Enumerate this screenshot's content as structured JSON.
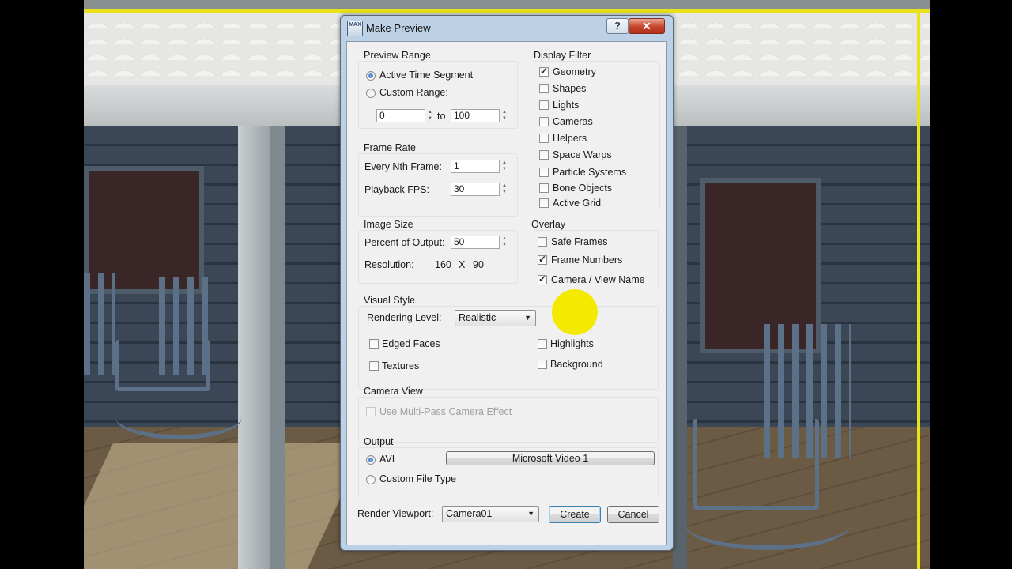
{
  "dialog": {
    "title": "Make Preview",
    "app_icon_text": "MAX",
    "help_glyph": "?",
    "close_glyph": "✕"
  },
  "preview_range": {
    "title": "Preview Range",
    "active_time_segment": "Active Time Segment",
    "custom_range": "Custom Range:",
    "from_value": "0",
    "to_label": "to",
    "to_value": "100",
    "selected": "Active Time Segment"
  },
  "frame_rate": {
    "title": "Frame Rate",
    "every_nth_label": "Every Nth Frame:",
    "every_nth_value": "1",
    "playback_fps_label": "Playback FPS:",
    "playback_fps_value": "30"
  },
  "image_size": {
    "title": "Image Size",
    "percent_label": "Percent of Output:",
    "percent_value": "50",
    "resolution_label": "Resolution:",
    "res_w": "160",
    "res_x": "X",
    "res_h": "90"
  },
  "display_filter": {
    "title": "Display Filter",
    "items": [
      {
        "label": "Geometry",
        "checked": true
      },
      {
        "label": "Shapes",
        "checked": false
      },
      {
        "label": "Lights",
        "checked": false
      },
      {
        "label": "Cameras",
        "checked": false
      },
      {
        "label": "Helpers",
        "checked": false
      },
      {
        "label": "Space Warps",
        "checked": false
      },
      {
        "label": "Particle Systems",
        "checked": false
      },
      {
        "label": "Bone Objects",
        "checked": false
      },
      {
        "label": "Active Grid",
        "checked": false
      }
    ]
  },
  "overlay": {
    "title": "Overlay",
    "items": [
      {
        "label": "Safe Frames",
        "checked": false
      },
      {
        "label": "Frame Numbers",
        "checked": true
      },
      {
        "label": "Camera / View Name",
        "checked": true
      }
    ]
  },
  "visual_style": {
    "title": "Visual Style",
    "rendering_level_label": "Rendering Level:",
    "rendering_level_value": "Realistic",
    "edged_faces": "Edged Faces",
    "textures": "Textures",
    "highlights": "Highlights",
    "background": "Background"
  },
  "camera_view": {
    "title": "Camera View",
    "multipass": "Use Multi-Pass Camera Effect"
  },
  "output": {
    "title": "Output",
    "avi": "AVI",
    "codec_button": "Microsoft Video 1",
    "custom_file_type": "Custom File Type",
    "selected": "AVI"
  },
  "footer": {
    "render_viewport_label": "Render Viewport:",
    "render_viewport_value": "Camera01",
    "create": "Create",
    "cancel": "Cancel"
  },
  "colors": {
    "dialog_frame": "#bcd1e6",
    "client_bg": "#f0f0f0",
    "highlight": "#f4ea00",
    "viewport_border": "#e8e21a"
  }
}
